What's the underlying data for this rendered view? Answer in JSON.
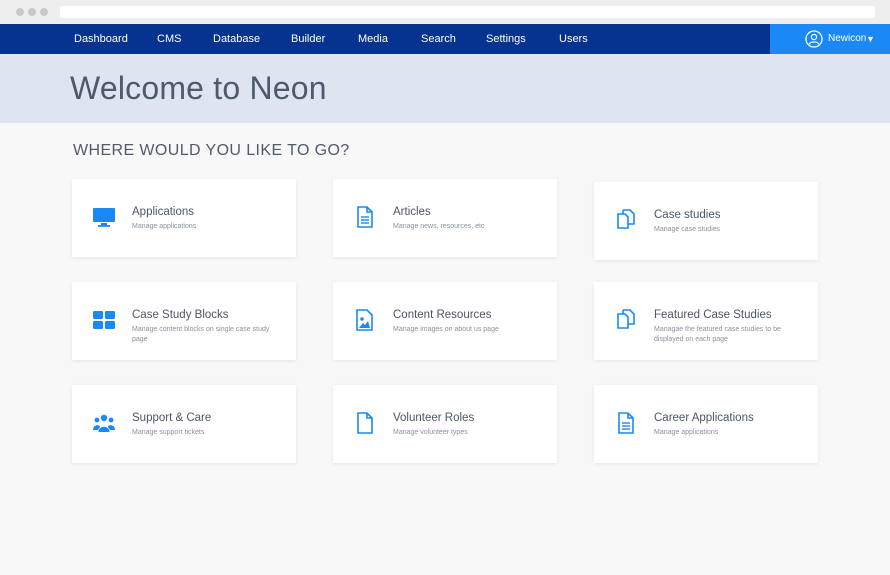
{
  "nav": {
    "items": [
      {
        "label": "Dashboard"
      },
      {
        "label": "CMS"
      },
      {
        "label": "Database"
      },
      {
        "label": "Builder"
      },
      {
        "label": "Media"
      },
      {
        "label": "Search"
      },
      {
        "label": "Settings"
      },
      {
        "label": "Users"
      }
    ],
    "user": {
      "name": "Newicon",
      "caret": "▼"
    }
  },
  "hero": {
    "title": "Welcome to Neon"
  },
  "section": {
    "title": "WHERE WOULD YOU LIKE TO GO?"
  },
  "colors": {
    "nav_bg": "#06338f",
    "accent": "#1a88f5",
    "hero_bg": "#dfe5f0"
  },
  "cards": [
    {
      "title": "Applications",
      "desc": "Manage applications",
      "icon": "monitor-icon"
    },
    {
      "title": "Articles",
      "desc": "Manage news, resources, etc",
      "icon": "document-icon"
    },
    {
      "title": "Case studies",
      "desc": "Manage case studies",
      "icon": "copy-icon"
    },
    {
      "title": "Case Study Blocks",
      "desc": "Manage content blocks on single case study page",
      "icon": "grid-icon"
    },
    {
      "title": "Content Resources",
      "desc": "Manage images on about us page",
      "icon": "image-icon"
    },
    {
      "title": "Featured Case Studies",
      "desc": "Managae the featured case studies to be displayed on each page",
      "icon": "copy-icon"
    },
    {
      "title": "Support & Care",
      "desc": "Manage support tickets",
      "icon": "users-icon"
    },
    {
      "title": "Volunteer Roles",
      "desc": "Manage volunteer types",
      "icon": "file-icon"
    },
    {
      "title": "Career Applications",
      "desc": "Manage applications",
      "icon": "document-icon"
    }
  ]
}
